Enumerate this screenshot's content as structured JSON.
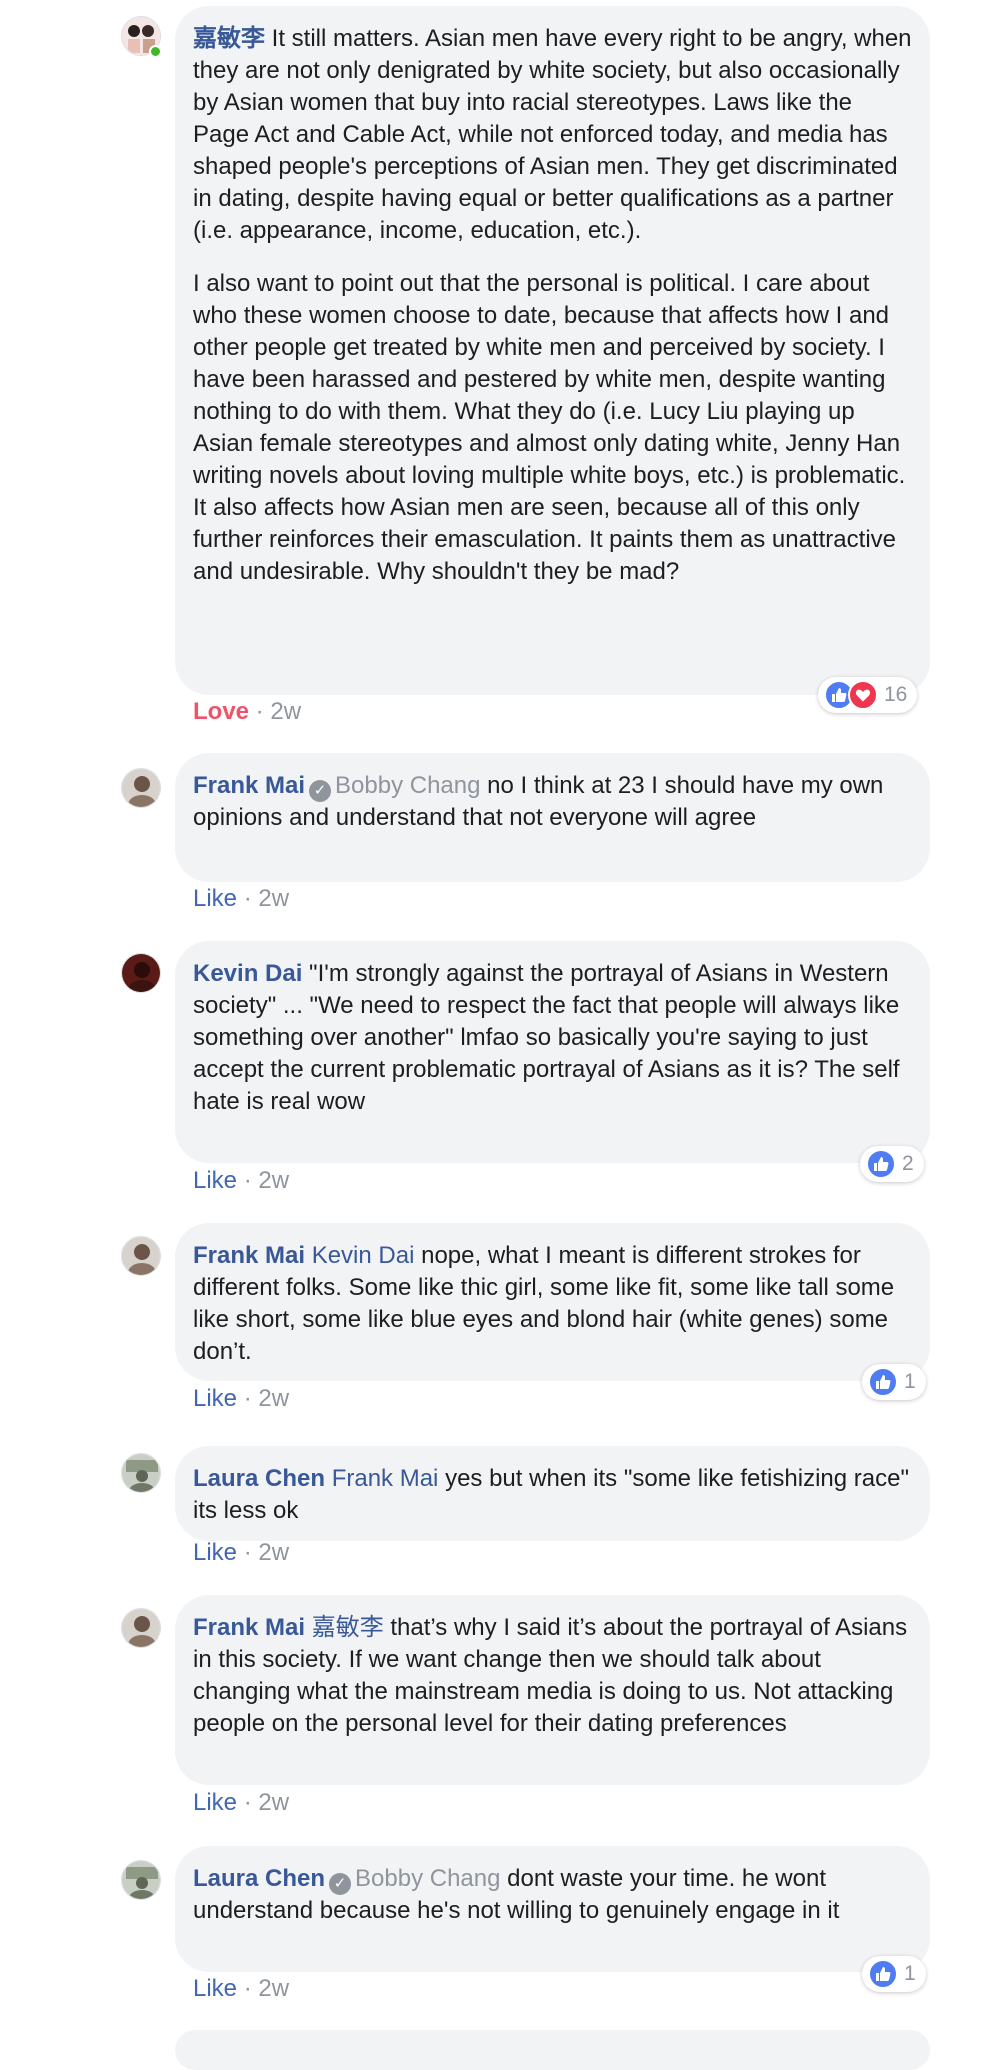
{
  "comments": [
    {
      "author": "嘉敏李",
      "online": true,
      "paragraphs": [
        "It still matters. Asian men have every right to be angry, when they are not only denigrated by white society, but also occasionally by Asian women that buy into racial stereotypes. Laws like the Page Act and Cable Act, while not enforced today, and media has shaped people's perceptions of Asian men. They get discriminated in dating, despite having equal or better qualifications as a partner (i.e. appearance, income, education, etc.).",
        "I also want to point out that the personal is political. I care about who these women choose to date, because that affects how I and other people get treated by white men and perceived by society. I have been harassed and pestered by white men, despite wanting nothing to do with them. What they do (i.e. Lucy Liu playing up Asian female stereotypes and almost only dating white, Jenny Han writing novels about loving multiple white boys, etc.) is problematic. It also affects how Asian men are seen, because all of this only further reinforces their emasculation. It paints them as unattractive and undesirable. Why shouldn't they be mad?"
      ],
      "action": "Love",
      "time": "2w",
      "reaction_count": "16"
    },
    {
      "author": "Frank Mai",
      "mention": "Bobby Chang",
      "text": "no I think at 23 I should have my own opinions and understand that not everyone will agree",
      "action": "Like",
      "time": "2w"
    },
    {
      "author": "Kevin Dai",
      "text": "\"I'm strongly against the portrayal of Asians in Western society\" ... \"We need to respect the fact that people will always like something over another\" lmfao so basically you're saying to just accept the current problematic portrayal of Asians as it is? The self hate is real wow",
      "action": "Like",
      "time": "2w",
      "reaction_count": "2"
    },
    {
      "author": "Frank Mai",
      "mention": "Kevin Dai",
      "text": "nope, what I meant is different strokes for different folks. Some like thic girl, some like fit, some like tall some like short, some like blue eyes and blond hair (white genes) some don’t.",
      "action": "Like",
      "time": "2w",
      "reaction_count": "1"
    },
    {
      "author": "Laura Chen",
      "mention": "Frank Mai",
      "text": "yes but when its \"some like fetishizing race\" its less ok",
      "action": "Like",
      "time": "2w"
    },
    {
      "author": "Frank Mai",
      "mention": "嘉敏李",
      "text": "that’s why I said it’s about the portrayal of Asians in this society. If we want change then we should talk about changing what the mainstream media is doing to us. Not attacking people on the personal level for their dating preferences",
      "action": "Like",
      "time": "2w"
    },
    {
      "author": "Laura Chen",
      "mention": "Bobby Chang",
      "text": "dont waste your time. he wont understand because he's not willing to genuinely engage in it",
      "action": "Like",
      "time": "2w",
      "reaction_count": "1"
    }
  ],
  "separator": " · ",
  "colors": {
    "link": "#385898",
    "action_like": "#4267b2",
    "love": "#f25268",
    "muted": "#90949c",
    "bubble": "#f2f3f5"
  }
}
